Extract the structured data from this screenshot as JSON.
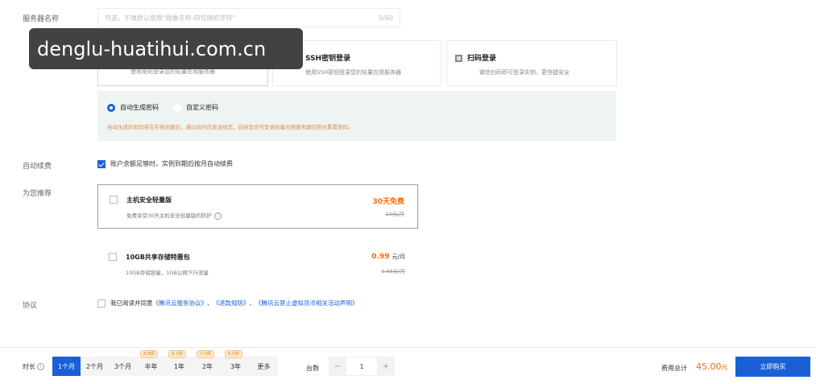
{
  "server_name": {
    "label": "服务器名称",
    "placeholder": "可选，不填默认使用\"镜像名称-四位随机字符\"",
    "counter": "0/60"
  },
  "login": {
    "cards": [
      {
        "title": "",
        "desc": "使用密码登录您的轻量应用服务器"
      },
      {
        "title": "SSH密钥登录",
        "desc": "使用SSH密钥登录您的轻量应用服务器"
      },
      {
        "title": "扫码登录",
        "desc": "微信扫码即可登录实例，更快捷安全"
      }
    ]
  },
  "watermark": "denglu-huatihui.com.cn",
  "password": {
    "options": [
      "自动生成密码",
      "自定义密码"
    ],
    "warning": "自动生成的密码将在实例创建后，通过站内信发送给您，后续您也可登录轻量应用服务器控制台重置密码。"
  },
  "auto_renew": {
    "label": "自动续费",
    "text": "账户余额足够时，实例到期后按月自动续费"
  },
  "recommend": {
    "label": "为您推荐",
    "items": [
      {
        "title": "主机安全轻量版",
        "desc": "免费享受30天主机安全轻量版的防护",
        "price": "30天免费",
        "unit": "",
        "original": "10元/月"
      },
      {
        "title": "10GB共享存储特惠包",
        "desc": "10GB存储容量，1GB公网下行流量",
        "price": "0.99",
        "unit": "元/月",
        "original": "1.68元/月"
      }
    ]
  },
  "agreement": {
    "label": "协议",
    "prefix": "我已阅读并同意",
    "link1": "《腾讯云服务协议》",
    "sep1": "、",
    "link2": "《退款规则》",
    "sep2": "、",
    "link3": "《腾讯云禁止虚拟货币相关活动声明》"
  },
  "bottom": {
    "duration_label": "时长",
    "info_icon": "i",
    "durations": [
      {
        "label": "1个月",
        "badge": ""
      },
      {
        "label": "2个月",
        "badge": ""
      },
      {
        "label": "3个月",
        "badge": ""
      },
      {
        "label": "半年",
        "badge": "8.8折"
      },
      {
        "label": "1年",
        "badge": "8.3折"
      },
      {
        "label": "2年",
        "badge": "7.0折"
      },
      {
        "label": "3年",
        "badge": "6.0折"
      },
      {
        "label": "更多",
        "badge": ""
      }
    ],
    "qty_label": "台数",
    "qty_minus": "−",
    "qty_value": "1",
    "qty_plus": "+",
    "total_label": "费用总计",
    "total_value": "45.00",
    "total_unit": "元",
    "buy_label": "立即购买"
  },
  "colors": {
    "accent": "#1a5fd6",
    "price": "#ff6a00",
    "panel": "#eef4f1"
  }
}
